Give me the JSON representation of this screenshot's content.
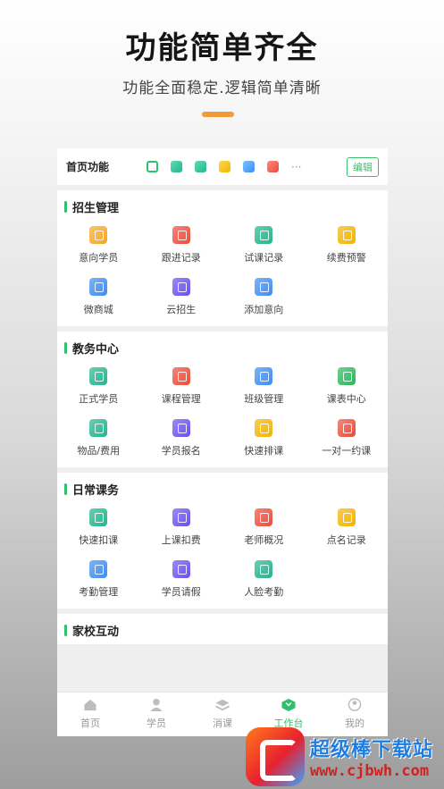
{
  "hero": {
    "title": "功能简单齐全",
    "subtitle": "功能全面稳定.逻辑简单清晰"
  },
  "quick_bar": {
    "title": "首页功能",
    "more": "···",
    "edit_label": "编辑",
    "icons": [
      "qr-code-icon",
      "teal-app-icon",
      "teal-app-icon",
      "yellow-app-icon",
      "blue-app-icon",
      "red-app-icon"
    ]
  },
  "sections": [
    {
      "title": "招生管理",
      "items": [
        {
          "label": "意向学员",
          "color": "#f6a623"
        },
        {
          "label": "跟进记录",
          "color": "#ec4b3b"
        },
        {
          "label": "试课记录",
          "color": "#23b48d"
        },
        {
          "label": "续费预警",
          "color": "#f2b400"
        },
        {
          "label": "微商城",
          "color": "#3d8cf4"
        },
        {
          "label": "云招生",
          "color": "#6a4ff0"
        },
        {
          "label": "添加意向",
          "color": "#3d8cf4"
        }
      ]
    },
    {
      "title": "教务中心",
      "items": [
        {
          "label": "正式学员",
          "color": "#23b48d"
        },
        {
          "label": "课程管理",
          "color": "#ec4b3b"
        },
        {
          "label": "班级管理",
          "color": "#3d8cf4"
        },
        {
          "label": "课表中心",
          "color": "#29b85a"
        },
        {
          "label": "物品/费用",
          "color": "#23b48d"
        },
        {
          "label": "学员报名",
          "color": "#6a4ff0"
        },
        {
          "label": "快速排课",
          "color": "#f2b400"
        },
        {
          "label": "一对一约课",
          "color": "#ec4b3b"
        }
      ]
    },
    {
      "title": "日常课务",
      "items": [
        {
          "label": "快速扣课",
          "color": "#23b48d"
        },
        {
          "label": "上课扣费",
          "color": "#6a4ff0"
        },
        {
          "label": "老师概况",
          "color": "#ec4b3b"
        },
        {
          "label": "点名记录",
          "color": "#f2b400"
        },
        {
          "label": "考勤管理",
          "color": "#3d8cf4"
        },
        {
          "label": "学员请假",
          "color": "#6a4ff0"
        },
        {
          "label": "人脸考勤",
          "color": "#23b48d"
        }
      ]
    },
    {
      "title": "家校互动",
      "items": []
    }
  ],
  "tabbar": [
    {
      "label": "首页",
      "icon": "home-icon",
      "active": false
    },
    {
      "label": "学员",
      "icon": "person-icon",
      "active": false
    },
    {
      "label": "消课",
      "icon": "layers-icon",
      "active": false
    },
    {
      "label": "工作台",
      "icon": "workbench-icon",
      "active": true
    },
    {
      "label": "我的",
      "icon": "profile-icon",
      "active": false
    }
  ],
  "watermark": {
    "title": "超级棒下载站",
    "url": "www.cjbwh.com"
  },
  "colors": {
    "accent": "#2fbf6d",
    "hero_bar": "#f19a38"
  }
}
